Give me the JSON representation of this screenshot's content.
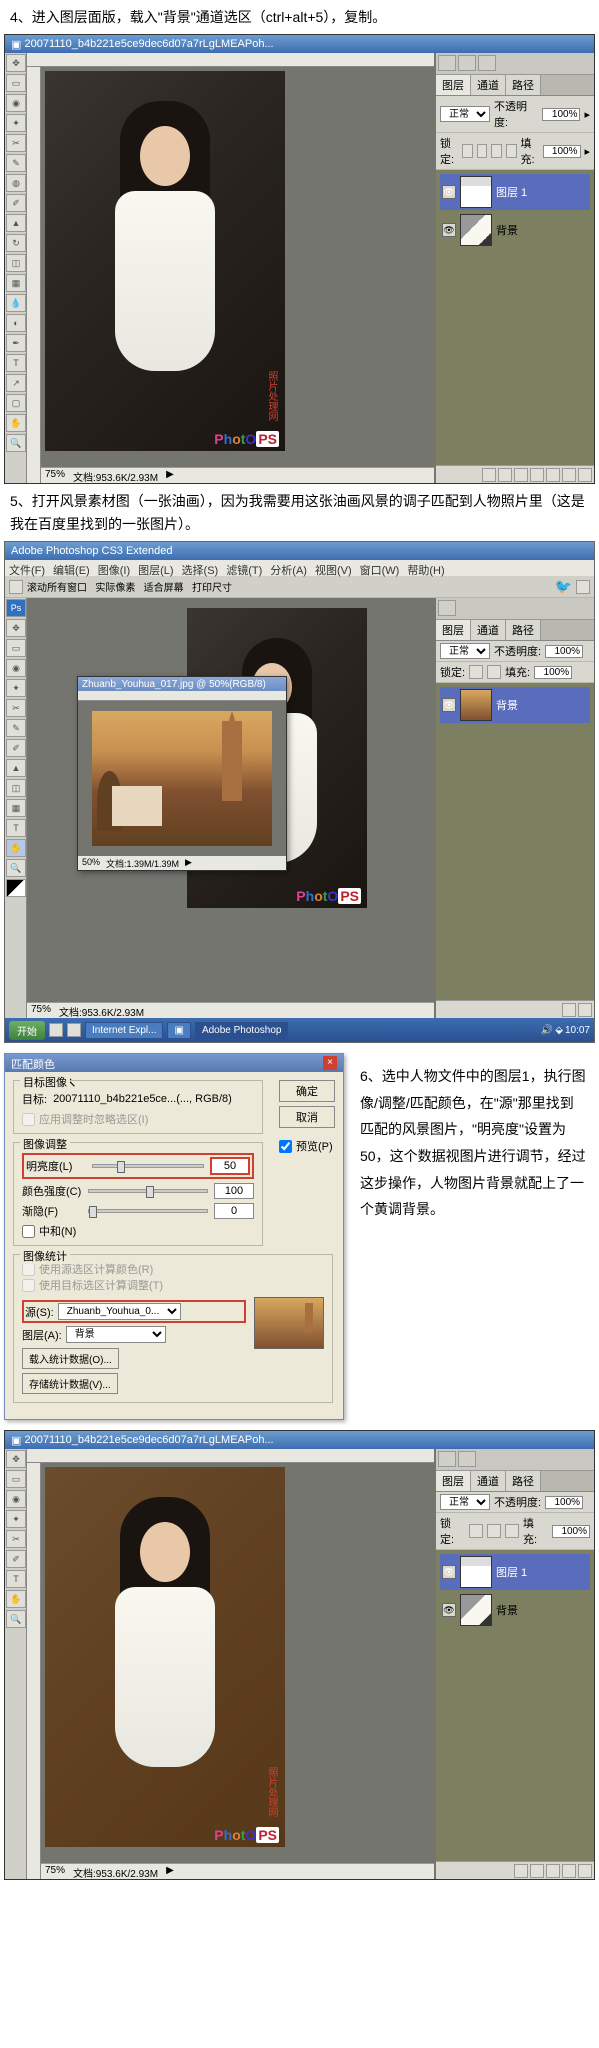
{
  "step4": {
    "text": "4、进入图层面版，载入\"背景\"通道选区（ctrl+alt+5），复制。"
  },
  "step5": {
    "text": "5、打开风景素材图（一张油画），因为我需要用这张油画风景的调子匹配到人物照片里（这是我在百度里找到的一张图片）。"
  },
  "step6": {
    "text": "6、选中人物文件中的图层1，执行图像/调整/匹配颜色，在\"源\"那里找到匹配的风景图片，\"明亮度\"设置为50，这个数据视图片进行调节，经过这步操作，人物图片背景就配上了一个黄调背景。"
  },
  "ps_title": "20071110_b4b221e5ce9dec6d07a7rLgLMEAPoh...",
  "ps_menu": [
    "文件(F)",
    "编辑(E)",
    "图像(I)",
    "图层(L)",
    "选择(S)",
    "滤镜(T)",
    "分析(A)",
    "视图(V)",
    "窗口(W)",
    "帮助(H)"
  ],
  "zoom": "75%",
  "doc_info": "文档:953.6K/2.93M",
  "panels": {
    "tabs": [
      "图层",
      "通道",
      "路径"
    ],
    "blend_mode": "正常",
    "opacity_label": "不透明度:",
    "opacity": "100%",
    "lock_label": "锁定:",
    "fill_label": "填充:",
    "fill": "100%",
    "layers": [
      {
        "name": "图层 1"
      },
      {
        "name": "背景"
      }
    ]
  },
  "watermark_text": "照片处理网",
  "logo": {
    "p": "P",
    "h": "h",
    "o1": "o",
    "t": "t",
    "o2": "O",
    "ps": "PS"
  },
  "full_ps": {
    "app_title": "Adobe Photoshop CS3 Extended",
    "floating_title": "Zhuanb_Youhua_017.jpg @ 50%(RGB/8)",
    "floating_zoom": "50%",
    "floating_doc": "文档:1.39M/1.39M"
  },
  "taskbar": {
    "start": "开始",
    "items": [
      "Internet Expl...",
      "",
      "Adobe Photoshop"
    ],
    "time": "10:07"
  },
  "dialog": {
    "title": "匹配颜色",
    "target_section": "目标图像",
    "target_label": "目标:",
    "target_value": "20071110_b4b221e5ce...(..., RGB/8)",
    "ignore_selection": "应用调整时忽略选区(I)",
    "options_section": "图像调整",
    "luminance_label": "明亮度(L)",
    "luminance_value": "50",
    "intensity_label": "颜色强度(C)",
    "intensity_value": "100",
    "fade_label": "渐隐(F)",
    "fade_value": "0",
    "neutralize": "中和(N)",
    "stats_section": "图像统计",
    "use_src_sel": "使用源选区计算颜色(R)",
    "use_tgt_sel": "使用目标选区计算调整(T)",
    "source_label": "源(S):",
    "source_value": "Zhuanb_Youhua_0...",
    "layer_label": "图层(A):",
    "layer_value": "背景",
    "load_stats": "载入统计数据(O)...",
    "save_stats": "存储统计数据(V)...",
    "ok": "确定",
    "cancel": "取消",
    "preview": "预览(P)"
  }
}
